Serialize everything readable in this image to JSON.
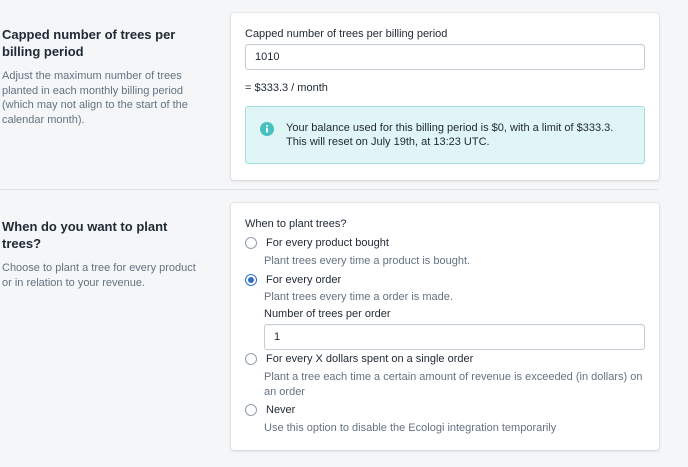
{
  "cap_section": {
    "title": "Capped number of trees per billing period",
    "description": "Adjust the maximum number of trees planted in each monthly billing period (which may not align to the start of the calendar month).",
    "field_label": "Capped number of trees per billing period",
    "field_value": "1010",
    "computed_cost": "= $333.3 / month",
    "banner": {
      "line1": "Your balance used for this billing period is $0, with a limit of $333.3.",
      "line2": "This will reset on July 19th, at 13:23 UTC.",
      "icon": "info-icon",
      "background": "#e0f5f5",
      "border": "#a3dbe0",
      "icon_color": "#47c1bf"
    }
  },
  "plant_section": {
    "title": "When do you want to plant trees?",
    "description": "Choose to plant a tree for every product or in relation to your revenue.",
    "group_label": "When to plant trees?",
    "options": [
      {
        "label": "For every product bought",
        "help": "Plant trees every time a product is bought.",
        "checked": false
      },
      {
        "label": "For every order",
        "help": "Plant trees every time a order is made.",
        "checked": true
      },
      {
        "label": "For every X dollars spent on a single order",
        "help": "Plant a tree each time a certain amount of revenue is exceeded (in dollars) on an order",
        "checked": false
      },
      {
        "label": "Never",
        "help": "Use this option to disable the Ecologi integration temporarily",
        "checked": false
      }
    ],
    "trees_per_order_label": "Number of trees per order",
    "trees_per_order_value": "1"
  },
  "colors": {
    "accent": "#2c6ecb",
    "text": "#212b36",
    "subdued": "#637381"
  }
}
